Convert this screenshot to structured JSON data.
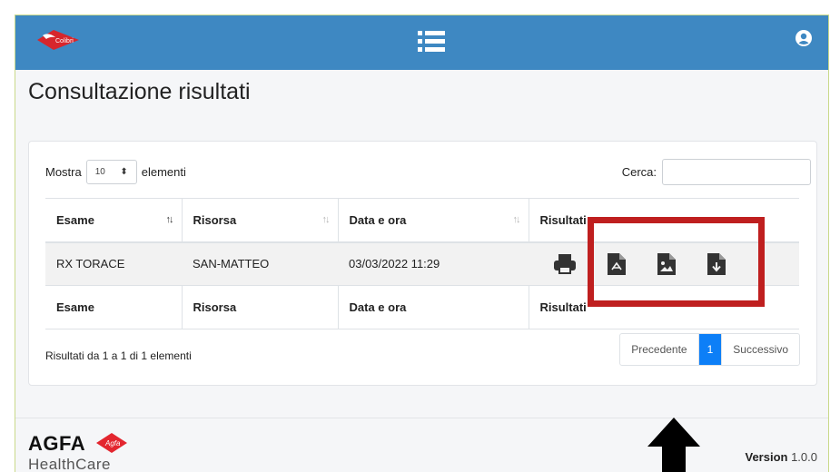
{
  "header": {
    "logo_text": "Colibri",
    "menu_icon": "list-icon",
    "user_icon": "user-circle-icon",
    "color": "#3e88c2"
  },
  "page": {
    "title": "Consultazione risultati"
  },
  "length_control": {
    "prefix": "Mostra",
    "value": "10",
    "suffix": "elementi"
  },
  "search": {
    "label": "Cerca:",
    "value": ""
  },
  "table": {
    "columns": [
      "Esame",
      "Risorsa",
      "Data e ora",
      "Risultati"
    ],
    "rows": [
      {
        "esame": "RX TORACE",
        "risorsa": "SAN-MATTEO",
        "data_ora": "03/03/2022 11:29",
        "actions": [
          "print-icon",
          "pdf-file-icon",
          "image-file-icon",
          "download-file-icon"
        ]
      }
    ],
    "footer_columns": [
      "Esame",
      "Risorsa",
      "Data e ora",
      "Risultati"
    ]
  },
  "info": "Risultati da 1 a 1 di 1 elementi",
  "pagination": {
    "prev": "Precedente",
    "current": "1",
    "next": "Successivo"
  },
  "footer": {
    "brand": "AGFA",
    "brand_badge": "Agfa",
    "sub_brand": "HealthCare",
    "version_label": "Version",
    "version_value": "1.0.0"
  },
  "annotation": {
    "highlight_color": "#bf1f1f",
    "arrow_icon": "arrow-up-icon"
  }
}
